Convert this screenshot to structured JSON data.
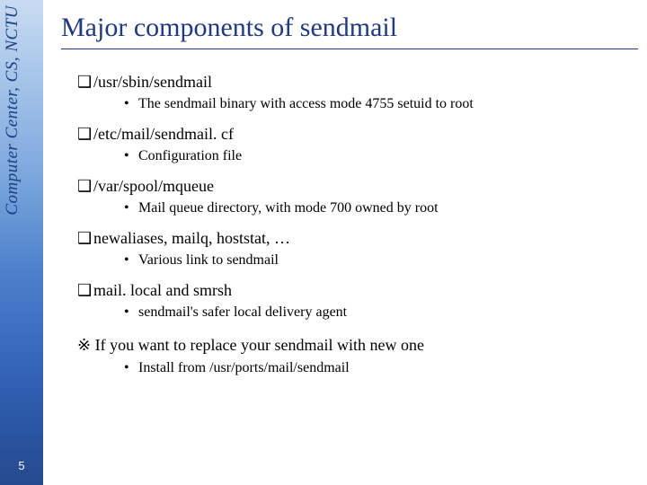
{
  "sidebar": {
    "org_text": "Computer Center, CS, NCTU",
    "page_number": "5"
  },
  "title": "Major components of sendmail",
  "items": [
    {
      "label": "/usr/sbin/sendmail",
      "sub": "The sendmail binary with access mode 4755 setuid to root"
    },
    {
      "label": "/etc/mail/sendmail. cf",
      "sub": "Configuration file"
    },
    {
      "label": "/var/spool/mqueue",
      "sub": "Mail queue directory, with mode 700 owned by root"
    },
    {
      "label": "newaliases, mailq, hoststat, …",
      "sub": "Various link to sendmail"
    },
    {
      "label": "mail. local and smrsh",
      "sub": "sendmail's safer local delivery agent"
    }
  ],
  "note": {
    "text": "※ If you want to replace your sendmail with new one",
    "sub": "Install from /usr/ports/mail/sendmail"
  },
  "glyph": {
    "square": "❑",
    "bullet": "•"
  }
}
